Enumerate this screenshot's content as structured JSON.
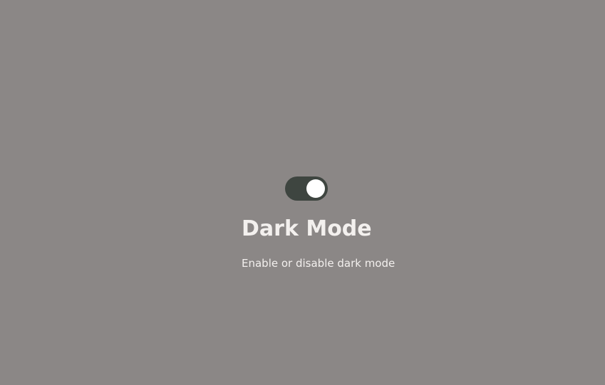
{
  "setting": {
    "title": "Dark Mode",
    "description": "Enable or disable dark mode",
    "toggle_on": true
  },
  "colors": {
    "background": "#8b8786",
    "toggle_track": "#3e4540",
    "toggle_knob": "#ffffff",
    "text": "#f3f0ee"
  }
}
